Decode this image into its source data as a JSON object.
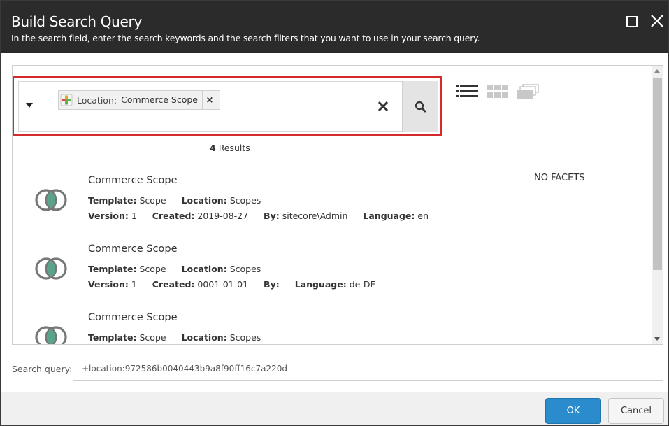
{
  "dialog": {
    "title": "Build Search Query",
    "subtitle": "In the search field, enter the search keywords and the search filters that you want to use in your search query."
  },
  "search": {
    "token_key": "Location:",
    "token_value": "Commerce Scope",
    "token_remove": "×",
    "highlight_color": "#d62a2a"
  },
  "results": {
    "count": "4",
    "count_label": "Results",
    "no_facets": "NO FACETS",
    "items": [
      {
        "title": "Commerce Scope",
        "template_label": "Template:",
        "template": "Scope",
        "location_label": "Location:",
        "location": "Scopes",
        "version_label": "Version:",
        "version": "1",
        "created_label": "Created:",
        "created": "2019-08-27",
        "by_label": "By:",
        "by": "sitecore\\Admin",
        "language_label": "Language:",
        "language": "en"
      },
      {
        "title": "Commerce Scope",
        "template_label": "Template:",
        "template": "Scope",
        "location_label": "Location:",
        "location": "Scopes",
        "version_label": "Version:",
        "version": "1",
        "created_label": "Created:",
        "created": "0001-01-01",
        "by_label": "By:",
        "by": "",
        "language_label": "Language:",
        "language": "de-DE"
      },
      {
        "title": "Commerce Scope",
        "template_label": "Template:",
        "template": "Scope",
        "location_label": "Location:",
        "location": "Scopes"
      }
    ]
  },
  "query": {
    "label": "Search query:",
    "value": "+location:972586b0040443b9a8f90ff16c7a220d"
  },
  "footer": {
    "ok_label": "OK",
    "cancel_label": "Cancel",
    "ok_color": "#2a8ccd"
  }
}
